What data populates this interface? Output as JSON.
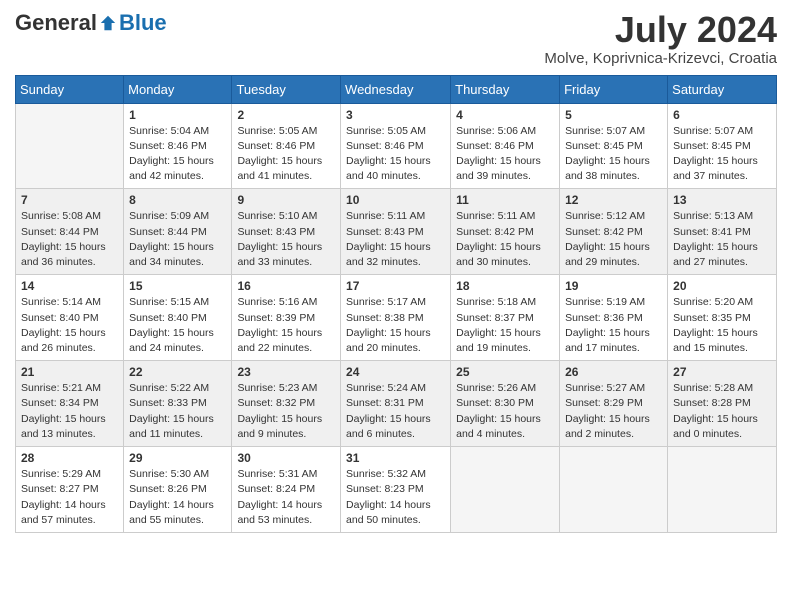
{
  "header": {
    "logo_general": "General",
    "logo_blue": "Blue",
    "month_title": "July 2024",
    "location": "Molve, Koprivnica-Krizevci, Croatia"
  },
  "days_of_week": [
    "Sunday",
    "Monday",
    "Tuesday",
    "Wednesday",
    "Thursday",
    "Friday",
    "Saturday"
  ],
  "weeks": [
    [
      {
        "day": "",
        "info": ""
      },
      {
        "day": "1",
        "info": "Sunrise: 5:04 AM\nSunset: 8:46 PM\nDaylight: 15 hours\nand 42 minutes."
      },
      {
        "day": "2",
        "info": "Sunrise: 5:05 AM\nSunset: 8:46 PM\nDaylight: 15 hours\nand 41 minutes."
      },
      {
        "day": "3",
        "info": "Sunrise: 5:05 AM\nSunset: 8:46 PM\nDaylight: 15 hours\nand 40 minutes."
      },
      {
        "day": "4",
        "info": "Sunrise: 5:06 AM\nSunset: 8:46 PM\nDaylight: 15 hours\nand 39 minutes."
      },
      {
        "day": "5",
        "info": "Sunrise: 5:07 AM\nSunset: 8:45 PM\nDaylight: 15 hours\nand 38 minutes."
      },
      {
        "day": "6",
        "info": "Sunrise: 5:07 AM\nSunset: 8:45 PM\nDaylight: 15 hours\nand 37 minutes."
      }
    ],
    [
      {
        "day": "7",
        "info": "Sunrise: 5:08 AM\nSunset: 8:44 PM\nDaylight: 15 hours\nand 36 minutes."
      },
      {
        "day": "8",
        "info": "Sunrise: 5:09 AM\nSunset: 8:44 PM\nDaylight: 15 hours\nand 34 minutes."
      },
      {
        "day": "9",
        "info": "Sunrise: 5:10 AM\nSunset: 8:43 PM\nDaylight: 15 hours\nand 33 minutes."
      },
      {
        "day": "10",
        "info": "Sunrise: 5:11 AM\nSunset: 8:43 PM\nDaylight: 15 hours\nand 32 minutes."
      },
      {
        "day": "11",
        "info": "Sunrise: 5:11 AM\nSunset: 8:42 PM\nDaylight: 15 hours\nand 30 minutes."
      },
      {
        "day": "12",
        "info": "Sunrise: 5:12 AM\nSunset: 8:42 PM\nDaylight: 15 hours\nand 29 minutes."
      },
      {
        "day": "13",
        "info": "Sunrise: 5:13 AM\nSunset: 8:41 PM\nDaylight: 15 hours\nand 27 minutes."
      }
    ],
    [
      {
        "day": "14",
        "info": "Sunrise: 5:14 AM\nSunset: 8:40 PM\nDaylight: 15 hours\nand 26 minutes."
      },
      {
        "day": "15",
        "info": "Sunrise: 5:15 AM\nSunset: 8:40 PM\nDaylight: 15 hours\nand 24 minutes."
      },
      {
        "day": "16",
        "info": "Sunrise: 5:16 AM\nSunset: 8:39 PM\nDaylight: 15 hours\nand 22 minutes."
      },
      {
        "day": "17",
        "info": "Sunrise: 5:17 AM\nSunset: 8:38 PM\nDaylight: 15 hours\nand 20 minutes."
      },
      {
        "day": "18",
        "info": "Sunrise: 5:18 AM\nSunset: 8:37 PM\nDaylight: 15 hours\nand 19 minutes."
      },
      {
        "day": "19",
        "info": "Sunrise: 5:19 AM\nSunset: 8:36 PM\nDaylight: 15 hours\nand 17 minutes."
      },
      {
        "day": "20",
        "info": "Sunrise: 5:20 AM\nSunset: 8:35 PM\nDaylight: 15 hours\nand 15 minutes."
      }
    ],
    [
      {
        "day": "21",
        "info": "Sunrise: 5:21 AM\nSunset: 8:34 PM\nDaylight: 15 hours\nand 13 minutes."
      },
      {
        "day": "22",
        "info": "Sunrise: 5:22 AM\nSunset: 8:33 PM\nDaylight: 15 hours\nand 11 minutes."
      },
      {
        "day": "23",
        "info": "Sunrise: 5:23 AM\nSunset: 8:32 PM\nDaylight: 15 hours\nand 9 minutes."
      },
      {
        "day": "24",
        "info": "Sunrise: 5:24 AM\nSunset: 8:31 PM\nDaylight: 15 hours\nand 6 minutes."
      },
      {
        "day": "25",
        "info": "Sunrise: 5:26 AM\nSunset: 8:30 PM\nDaylight: 15 hours\nand 4 minutes."
      },
      {
        "day": "26",
        "info": "Sunrise: 5:27 AM\nSunset: 8:29 PM\nDaylight: 15 hours\nand 2 minutes."
      },
      {
        "day": "27",
        "info": "Sunrise: 5:28 AM\nSunset: 8:28 PM\nDaylight: 15 hours\nand 0 minutes."
      }
    ],
    [
      {
        "day": "28",
        "info": "Sunrise: 5:29 AM\nSunset: 8:27 PM\nDaylight: 14 hours\nand 57 minutes."
      },
      {
        "day": "29",
        "info": "Sunrise: 5:30 AM\nSunset: 8:26 PM\nDaylight: 14 hours\nand 55 minutes."
      },
      {
        "day": "30",
        "info": "Sunrise: 5:31 AM\nSunset: 8:24 PM\nDaylight: 14 hours\nand 53 minutes."
      },
      {
        "day": "31",
        "info": "Sunrise: 5:32 AM\nSunset: 8:23 PM\nDaylight: 14 hours\nand 50 minutes."
      },
      {
        "day": "",
        "info": ""
      },
      {
        "day": "",
        "info": ""
      },
      {
        "day": "",
        "info": ""
      }
    ]
  ]
}
